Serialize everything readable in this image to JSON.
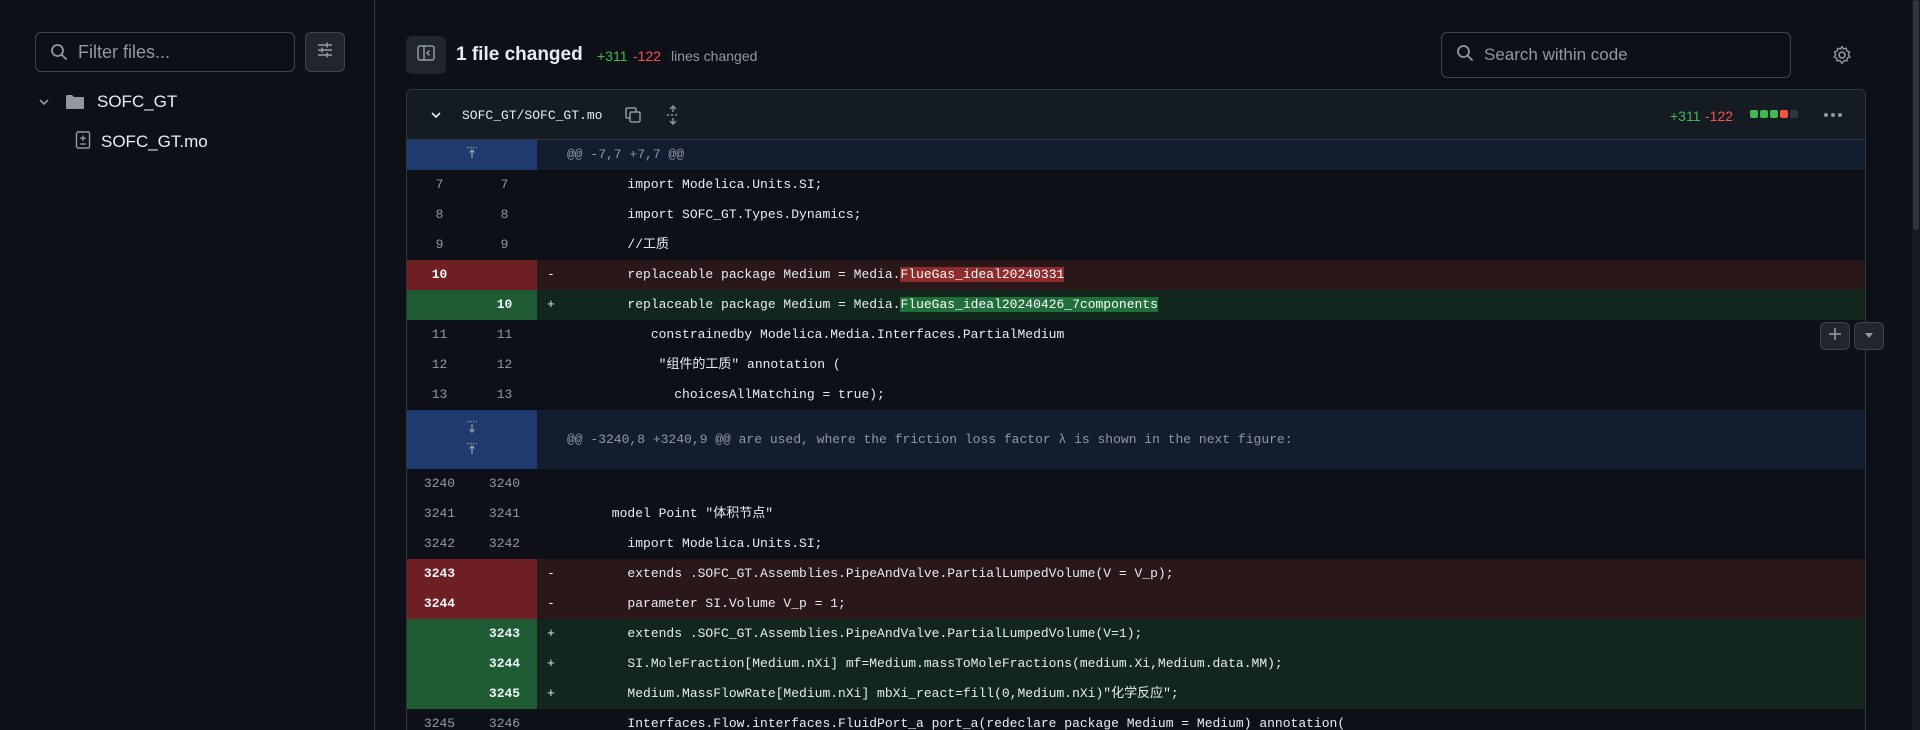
{
  "sidebar": {
    "filter_placeholder": "Filter files...",
    "tree": {
      "folder": "SOFC_GT",
      "file": "SOFC_GT.mo"
    }
  },
  "header": {
    "files_changed": "1 file changed",
    "additions": "+311",
    "deletions": "-122",
    "lines_changed": "lines changed",
    "search_placeholder": "Search within code"
  },
  "file": {
    "path": "SOFC_GT/SOFC_GT.mo",
    "additions": "+311",
    "deletions": "-122",
    "stat_colors": [
      "#3fb950",
      "#3fb950",
      "#3fb950",
      "#f85149",
      "#30363d"
    ]
  },
  "hunks": {
    "h1": "@@ -7,7 +7,7 @@",
    "h2": "@@ -3240,8 +3240,9 @@ are used, where the friction loss factor λ is shown in the next figure:"
  },
  "rows": [
    {
      "old": "7",
      "new": "7",
      "sign": "",
      "text": "        import Modelica.Units.SI;"
    },
    {
      "old": "8",
      "new": "8",
      "sign": "",
      "text": "        import SOFC_GT.Types.Dynamics;"
    },
    {
      "old": "9",
      "new": "9",
      "sign": "",
      "text": "        //工质"
    },
    {
      "old": "10",
      "new": "",
      "sign": "-",
      "text_pre": "        replaceable package Medium = Media.",
      "text_mark": "FlueGas_ideal20240331"
    },
    {
      "old": "",
      "new": "10",
      "sign": "+",
      "text_pre": "        replaceable package Medium = Media.",
      "text_mark": "FlueGas_ideal20240426_7components"
    },
    {
      "old": "11",
      "new": "11",
      "sign": "",
      "text": "           constrainedby Modelica.Media.Interfaces.PartialMedium"
    },
    {
      "old": "12",
      "new": "12",
      "sign": "",
      "text": "            \"组件的工质\" annotation ("
    },
    {
      "old": "13",
      "new": "13",
      "sign": "",
      "text": "              choicesAllMatching = true);"
    },
    {
      "old": "3240",
      "new": "3240",
      "sign": "",
      "text": ""
    },
    {
      "old": "3241",
      "new": "3241",
      "sign": "",
      "text": "      model Point \"体积节点\""
    },
    {
      "old": "3242",
      "new": "3242",
      "sign": "",
      "text": "        import Modelica.Units.SI;"
    },
    {
      "old": "3243",
      "new": "",
      "sign": "-",
      "text": "        extends .SOFC_GT.Assemblies.PipeAndValve.PartialLumpedVolume(V = V_p);"
    },
    {
      "old": "3244",
      "new": "",
      "sign": "-",
      "text": "        parameter SI.Volume V_p = 1;"
    },
    {
      "old": "",
      "new": "3243",
      "sign": "+",
      "text": "        extends .SOFC_GT.Assemblies.PipeAndValve.PartialLumpedVolume(V=1);"
    },
    {
      "old": "",
      "new": "3244",
      "sign": "+",
      "text": "        SI.MoleFraction[Medium.nXi] mf=Medium.massToMoleFractions(medium.Xi,Medium.data.MM);"
    },
    {
      "old": "",
      "new": "3245",
      "sign": "+",
      "text": "        Medium.MassFlowRate[Medium.nXi] mbXi_react=fill(0,Medium.nXi)\"化学反应\";"
    },
    {
      "old": "3245",
      "new": "3246",
      "sign": "",
      "text": "        Interfaces.Flow.interfaces.FluidPort_a port_a(redeclare package Medium = Medium) annotation("
    }
  ]
}
